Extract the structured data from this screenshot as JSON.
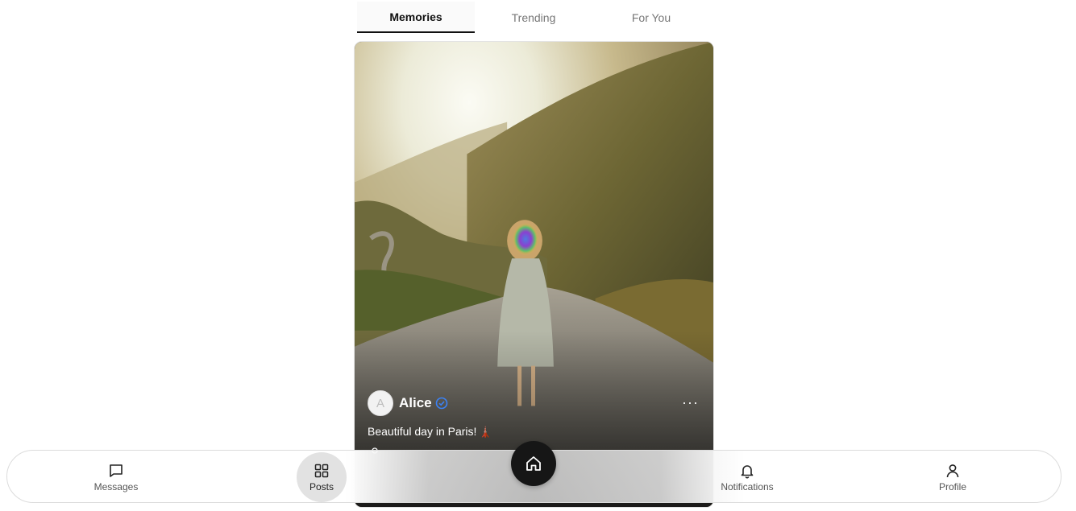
{
  "tabs": [
    {
      "label": "Memories",
      "active": true
    },
    {
      "label": "Trending",
      "active": false
    },
    {
      "label": "For You",
      "active": false
    }
  ],
  "post": {
    "avatar_initial": "A",
    "username": "Alice",
    "verified": true,
    "caption": "Beautiful day in Paris!",
    "caption_emoji": "🗼",
    "more_label": "···",
    "image_description_icon": "photo"
  },
  "nav": {
    "messages_label": "Messages",
    "posts_label": "Posts",
    "notifications_label": "Notifications",
    "profile_label": "Profile",
    "active": "Posts"
  },
  "colors": {
    "accent": "#111111",
    "verified": "#3b82f6",
    "nav_active_bg": "#e2e2e2"
  }
}
